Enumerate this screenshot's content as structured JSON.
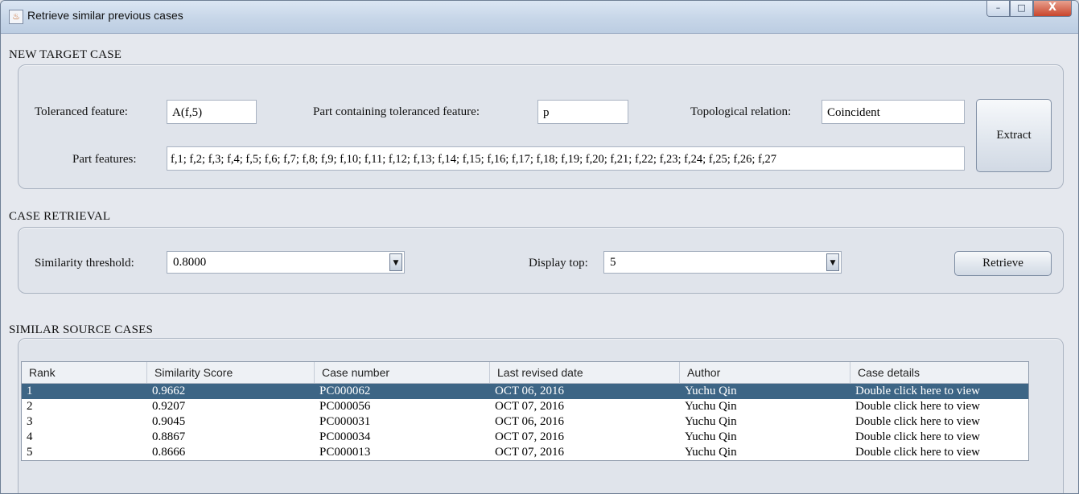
{
  "window": {
    "title": "Retrieve similar previous cases",
    "controls": [
      "–",
      "□",
      "X"
    ]
  },
  "new_target_case": {
    "heading": "NEW TARGET CASE",
    "toleranced_feature": {
      "label": "Toleranced feature:",
      "value": "A(f,5)"
    },
    "part_containing": {
      "label": "Part containing toleranced feature:",
      "value": "p"
    },
    "topological_relation": {
      "label": "Topological relation:",
      "value": "Coincident"
    },
    "part_features": {
      "label": "Part features:",
      "value": "f,1; f,2; f,3; f,4; f,5; f,6; f,7; f,8; f,9; f,10; f,11; f,12; f,13; f,14; f,15; f,16; f,17; f,18; f,19; f,20; f,21; f,22; f,23; f,24; f,25; f,26; f,27"
    },
    "extract_label": "Extract"
  },
  "case_retrieval": {
    "heading": "CASE RETRIEVAL",
    "threshold": {
      "label": "Similarity threshold:",
      "value": "0.8000"
    },
    "display_top": {
      "label": "Display top:",
      "value": "5"
    },
    "retrieve_label": "Retrieve"
  },
  "similar_source_cases": {
    "heading": "SIMILAR SOURCE CASES",
    "columns": [
      "Rank",
      "Similarity Score",
      "Case number",
      "Last revised date",
      "Author",
      "Case details"
    ],
    "rows": [
      [
        "1",
        "0.9662",
        "PC000062",
        "OCT 06, 2016",
        "Yuchu Qin",
        "Double click here to view"
      ],
      [
        "2",
        "0.9207",
        "PC000056",
        "OCT 07, 2016",
        "Yuchu Qin",
        "Double click here to view"
      ],
      [
        "3",
        "0.9045",
        "PC000031",
        "OCT 06, 2016",
        "Yuchu Qin",
        "Double click here to view"
      ],
      [
        "4",
        "0.8867",
        "PC000034",
        "OCT 07, 2016",
        "Yuchu Qin",
        "Double click here to view"
      ],
      [
        "5",
        "0.8666",
        "PC000013",
        "OCT 07, 2016",
        "Yuchu Qin",
        "Double click here to view"
      ]
    ],
    "selected_row": 1
  },
  "colors": {
    "selection": "#3d6585",
    "titlebar": "#c7d6e8",
    "background": "#e5e8ee"
  }
}
